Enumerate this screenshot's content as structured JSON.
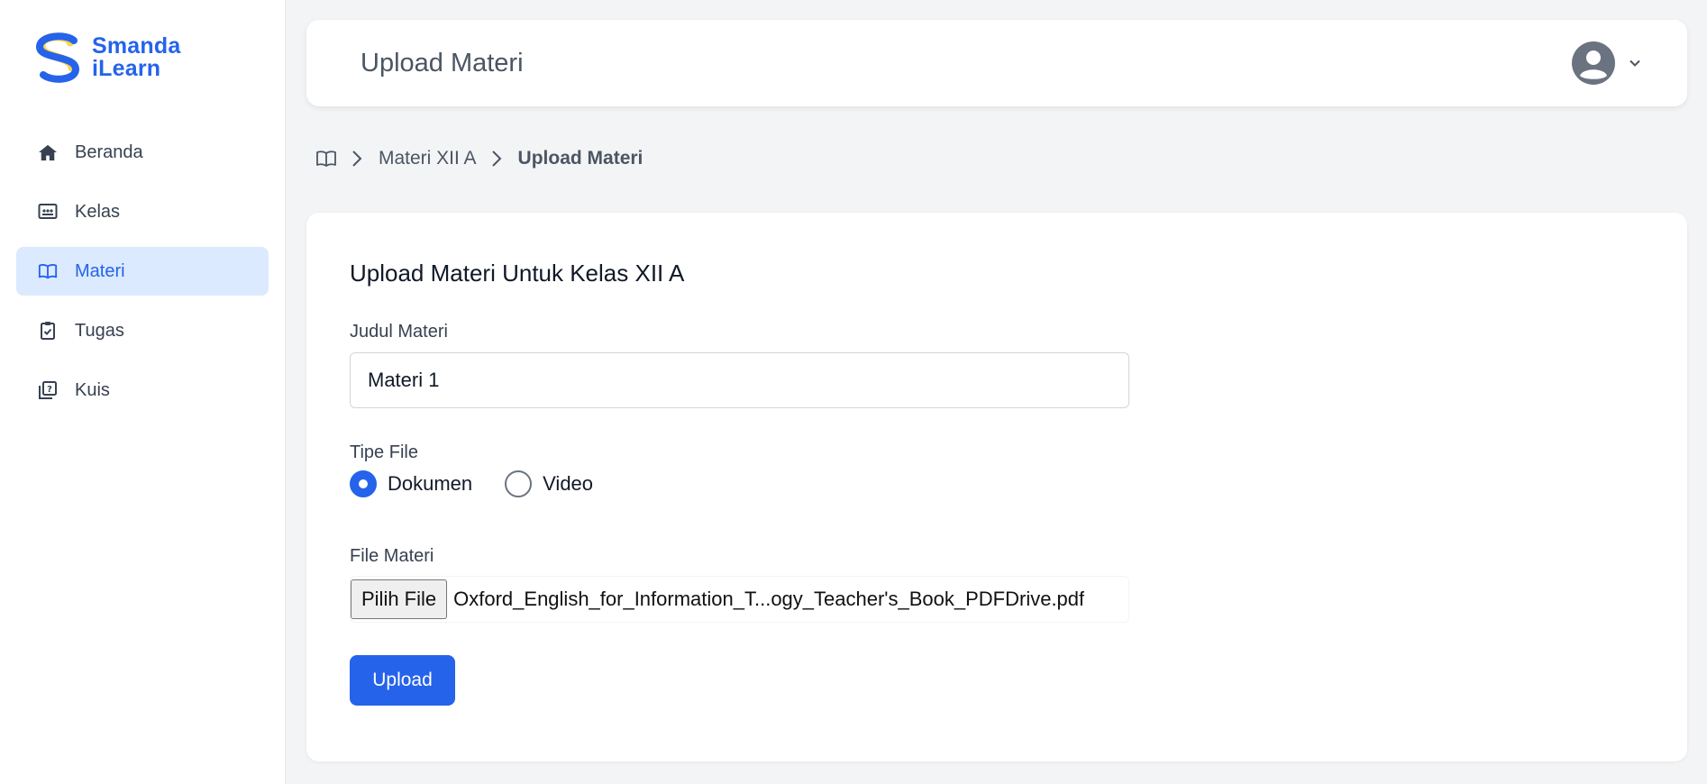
{
  "brand": {
    "line1": "Smanda",
    "line2": "iLearn",
    "color": "#2563eb",
    "accent": "#fcd34d"
  },
  "sidebar": {
    "items": [
      {
        "label": "Beranda",
        "icon": "home-icon",
        "active": false
      },
      {
        "label": "Kelas",
        "icon": "classroom-icon",
        "active": false
      },
      {
        "label": "Materi",
        "icon": "book-open-icon",
        "active": true
      },
      {
        "label": "Tugas",
        "icon": "clipboard-check-icon",
        "active": false
      },
      {
        "label": "Kuis",
        "icon": "quiz-icon",
        "active": false
      }
    ]
  },
  "header": {
    "title": "Upload Materi",
    "user_icon": "user-avatar-icon",
    "menu_icon": "chevron-down-icon"
  },
  "breadcrumb": {
    "home_icon": "book-open-icon",
    "items": [
      {
        "label": "Materi XII A"
      },
      {
        "label": "Upload Materi"
      }
    ]
  },
  "form": {
    "title": "Upload Materi Untuk Kelas XII A",
    "judul": {
      "label": "Judul Materi",
      "value": "Materi 1"
    },
    "tipe": {
      "label": "Tipe File",
      "options": [
        {
          "label": "Dokumen",
          "selected": true
        },
        {
          "label": "Video",
          "selected": false
        }
      ]
    },
    "file": {
      "label": "File Materi",
      "button_label": "Pilih File",
      "file_name": "Oxford_English_for_Information_T...ogy_Teacher's_Book_PDFDrive.pdf"
    },
    "submit_label": "Upload"
  },
  "colors": {
    "primary": "#2563eb",
    "active_bg": "#dbeafe",
    "page_bg": "#f3f4f6"
  }
}
